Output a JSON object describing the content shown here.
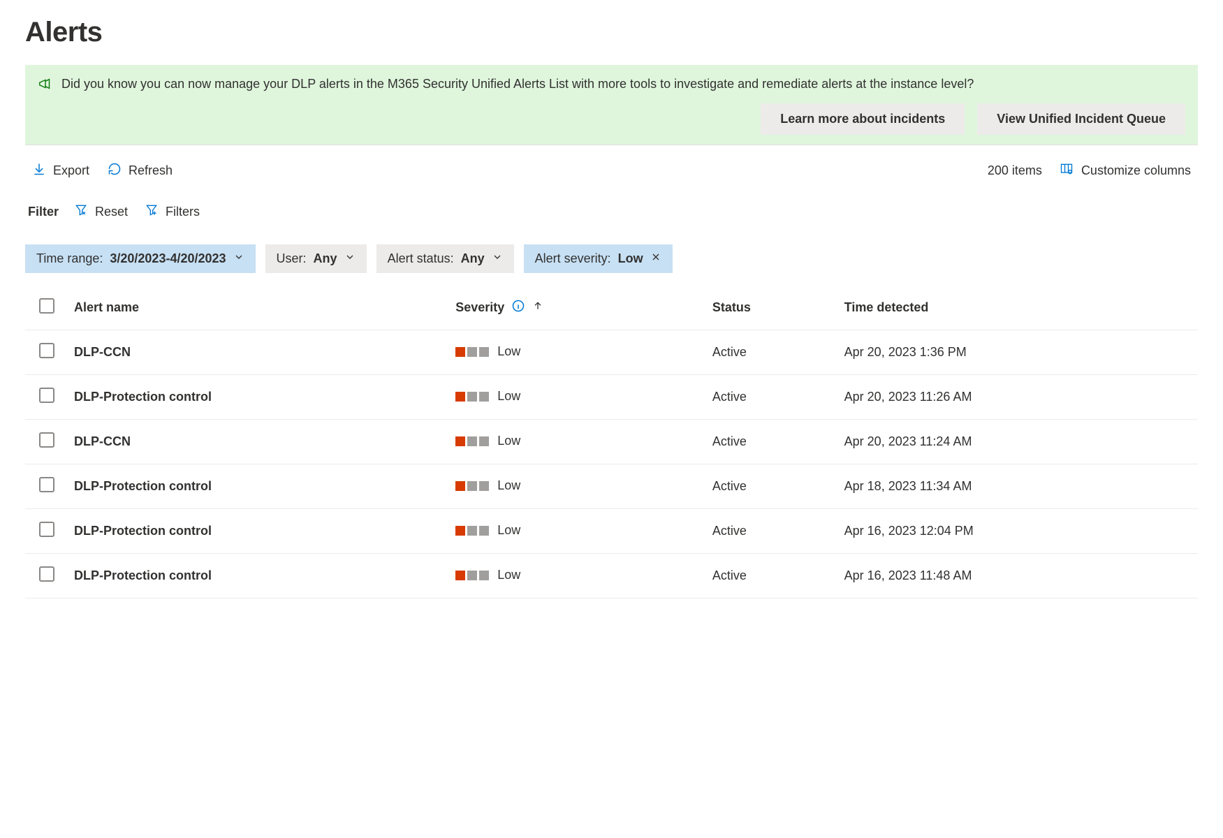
{
  "page": {
    "title": "Alerts"
  },
  "banner": {
    "text": "Did you know you can now manage your DLP alerts in the M365 Security Unified Alerts List with more tools to investigate and remediate alerts at the instance level?",
    "learn_more": "Learn more about incidents",
    "view_queue": "View Unified Incident Queue"
  },
  "toolbar": {
    "export": "Export",
    "refresh": "Refresh",
    "item_count": "200 items",
    "customize": "Customize columns"
  },
  "filter": {
    "label": "Filter",
    "reset": "Reset",
    "filters": "Filters",
    "time_range": {
      "label": "Time range:",
      "value": "3/20/2023-4/20/2023"
    },
    "user": {
      "label": "User:",
      "value": "Any"
    },
    "status": {
      "label": "Alert status:",
      "value": "Any"
    },
    "severity": {
      "label": "Alert severity:",
      "value": "Low"
    }
  },
  "columns": {
    "name": "Alert name",
    "severity": "Severity",
    "status": "Status",
    "time": "Time detected"
  },
  "rows": [
    {
      "name": "DLP-CCN",
      "severity": "Low",
      "status": "Active",
      "time": "Apr 20, 2023 1:36 PM"
    },
    {
      "name": "DLP-Protection control",
      "severity": "Low",
      "status": "Active",
      "time": "Apr 20, 2023 11:26 AM"
    },
    {
      "name": "DLP-CCN",
      "severity": "Low",
      "status": "Active",
      "time": "Apr 20, 2023 11:24 AM"
    },
    {
      "name": "DLP-Protection control",
      "severity": "Low",
      "status": "Active",
      "time": "Apr 18, 2023 11:34 AM"
    },
    {
      "name": "DLP-Protection control",
      "severity": "Low",
      "status": "Active",
      "time": "Apr 16, 2023 12:04 PM"
    },
    {
      "name": "DLP-Protection control",
      "severity": "Low",
      "status": "Active",
      "time": "Apr 16, 2023 11:48 AM"
    }
  ]
}
